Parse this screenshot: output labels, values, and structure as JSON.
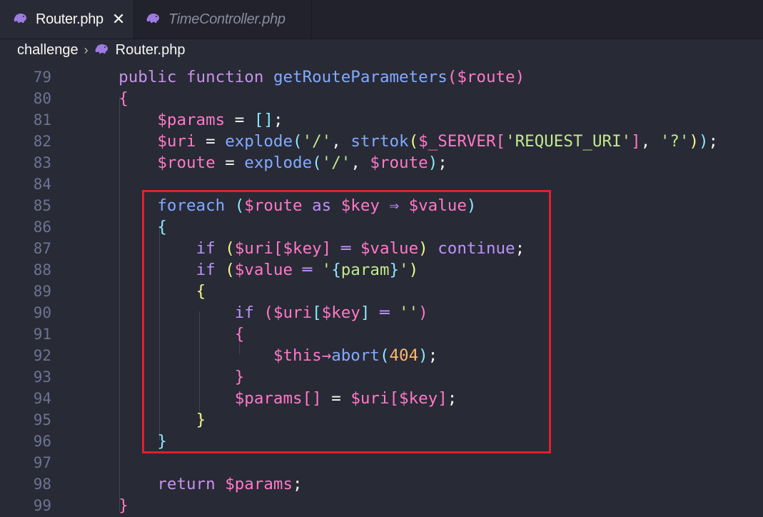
{
  "tabs": [
    {
      "label": "Router.php",
      "active": true,
      "icon": "php-elephant-icon"
    },
    {
      "label": "TimeController.php",
      "active": false,
      "icon": "php-elephant-icon"
    }
  ],
  "tab_close_glyph": "✕",
  "breadcrumb": {
    "folder": "challenge",
    "separator": "›",
    "file": "Router.php"
  },
  "colors": {
    "highlight_box": "#e0202c",
    "background": "#282a36",
    "php_icon": "#9d7be0"
  },
  "code": {
    "line_numbers": [
      "79",
      "80",
      "81",
      "82",
      "83",
      "84",
      "85",
      "86",
      "87",
      "88",
      "89",
      "90",
      "91",
      "92",
      "93",
      "94",
      "95",
      "96",
      "97",
      "98",
      "99"
    ],
    "lines": [
      [
        [
          "    public ",
          "kw"
        ],
        [
          "function ",
          "kw"
        ],
        [
          "getRouteParameters",
          "fn"
        ],
        [
          "(",
          "b1"
        ],
        [
          "$route",
          "v"
        ],
        [
          ")",
          "b1"
        ]
      ],
      [
        [
          "    ",
          "p"
        ],
        [
          "{",
          "b1"
        ]
      ],
      [
        [
          "        ",
          "p"
        ],
        [
          "$params",
          "v"
        ],
        [
          " = ",
          "p"
        ],
        [
          "[]",
          "b2"
        ],
        [
          ";",
          "p"
        ]
      ],
      [
        [
          "        ",
          "p"
        ],
        [
          "$uri",
          "v"
        ],
        [
          " = ",
          "p"
        ],
        [
          "explode",
          "fn"
        ],
        [
          "(",
          "b2"
        ],
        [
          "'/'",
          "s"
        ],
        [
          ", ",
          "p"
        ],
        [
          "strtok",
          "fn"
        ],
        [
          "(",
          "b3"
        ],
        [
          "$_SERVER",
          "v"
        ],
        [
          "[",
          "b1"
        ],
        [
          "'REQUEST_URI'",
          "s"
        ],
        [
          "]",
          "b1"
        ],
        [
          ", ",
          "p"
        ],
        [
          "'?'",
          "s"
        ],
        [
          ")",
          "b3"
        ],
        [
          ")",
          "b2"
        ],
        [
          ";",
          "p"
        ]
      ],
      [
        [
          "        ",
          "p"
        ],
        [
          "$route",
          "v"
        ],
        [
          " = ",
          "p"
        ],
        [
          "explode",
          "fn"
        ],
        [
          "(",
          "b2"
        ],
        [
          "'/'",
          "s"
        ],
        [
          ", ",
          "p"
        ],
        [
          "$route",
          "v"
        ],
        [
          ")",
          "b2"
        ],
        [
          ";",
          "p"
        ]
      ],
      [
        [
          "",
          "p"
        ]
      ],
      [
        [
          "        ",
          "p"
        ],
        [
          "foreach ",
          "fn"
        ],
        [
          "(",
          "b2"
        ],
        [
          "$route",
          "v"
        ],
        [
          " as ",
          "k"
        ],
        [
          "$key",
          "v"
        ],
        [
          " ⇒ ",
          "k"
        ],
        [
          "$value",
          "v"
        ],
        [
          ")",
          "b2"
        ]
      ],
      [
        [
          "        ",
          "p"
        ],
        [
          "{",
          "b2"
        ]
      ],
      [
        [
          "            ",
          "p"
        ],
        [
          "if ",
          "k"
        ],
        [
          "(",
          "b3"
        ],
        [
          "$uri",
          "v"
        ],
        [
          "[",
          "b1"
        ],
        [
          "$key",
          "v"
        ],
        [
          "]",
          "b1"
        ],
        [
          " ═ ",
          "k"
        ],
        [
          "$value",
          "v"
        ],
        [
          ")",
          "b3"
        ],
        [
          " continue",
          "k"
        ],
        [
          ";",
          "p"
        ]
      ],
      [
        [
          "            ",
          "p"
        ],
        [
          "if ",
          "k"
        ],
        [
          "(",
          "b3"
        ],
        [
          "$value",
          "v"
        ],
        [
          " ═ ",
          "k"
        ],
        [
          "'",
          "s"
        ],
        [
          "{",
          "b2"
        ],
        [
          "param",
          "s"
        ],
        [
          "}",
          "b2"
        ],
        [
          "'",
          "s"
        ],
        [
          ")",
          "b3"
        ]
      ],
      [
        [
          "            ",
          "p"
        ],
        [
          "{",
          "b3"
        ]
      ],
      [
        [
          "                ",
          "p"
        ],
        [
          "if ",
          "k"
        ],
        [
          "(",
          "b1"
        ],
        [
          "$uri",
          "v"
        ],
        [
          "[",
          "b2"
        ],
        [
          "$key",
          "v"
        ],
        [
          "]",
          "b2"
        ],
        [
          " ═ ",
          "k"
        ],
        [
          "''",
          "s"
        ],
        [
          ")",
          "b1"
        ]
      ],
      [
        [
          "                ",
          "p"
        ],
        [
          "{",
          "b1"
        ]
      ],
      [
        [
          "                    ",
          "p"
        ],
        [
          "$this",
          "v"
        ],
        [
          "→",
          "v"
        ],
        [
          "abort",
          "fn"
        ],
        [
          "(",
          "b2"
        ],
        [
          "404",
          "n"
        ],
        [
          ")",
          "b2"
        ],
        [
          ";",
          "p"
        ]
      ],
      [
        [
          "                ",
          "p"
        ],
        [
          "}",
          "b1"
        ]
      ],
      [
        [
          "                ",
          "p"
        ],
        [
          "$params",
          "v"
        ],
        [
          "[]",
          "b1"
        ],
        [
          " = ",
          "p"
        ],
        [
          "$uri",
          "v"
        ],
        [
          "[",
          "b1"
        ],
        [
          "$key",
          "v"
        ],
        [
          "]",
          "b1"
        ],
        [
          ";",
          "p"
        ]
      ],
      [
        [
          "            ",
          "p"
        ],
        [
          "}",
          "b3"
        ]
      ],
      [
        [
          "        ",
          "p"
        ],
        [
          "}",
          "b2"
        ]
      ],
      [
        [
          "",
          "p"
        ]
      ],
      [
        [
          "        ",
          "p"
        ],
        [
          "return ",
          "kw"
        ],
        [
          "$params",
          "v"
        ],
        [
          ";",
          "p"
        ]
      ],
      [
        [
          "    ",
          "p"
        ],
        [
          "}",
          "b1"
        ]
      ]
    ]
  }
}
